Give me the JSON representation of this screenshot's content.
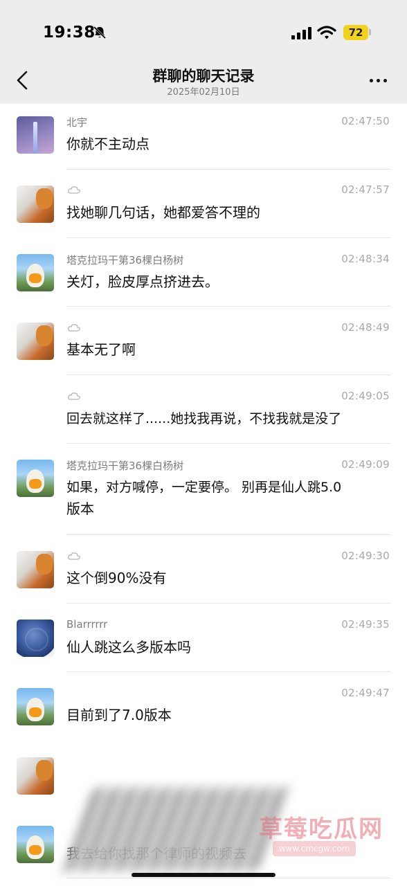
{
  "status": {
    "time": "19:38",
    "battery": "72"
  },
  "header": {
    "title": "群聊的聊天记录",
    "date": "2025年02月10日"
  },
  "messages": [
    {
      "sender": "北宇",
      "avatar": "tower-avatar",
      "time": "02:47:50",
      "text": "你就不主动点"
    },
    {
      "sender": "",
      "avatar": "dog-avatar",
      "sender_icon": "cloud-icon",
      "time": "02:47:57",
      "text": "找她聊几句话，她都爱答不理的"
    },
    {
      "sender": "塔克拉玛干第36棵白杨树",
      "avatar": "duck-avatar",
      "time": "02:48:34",
      "text": "关灯，脸皮厚点挤进去。"
    },
    {
      "sender": "",
      "avatar": "dog-avatar",
      "sender_icon": "cloud-icon",
      "time": "02:48:49",
      "text": "基本无了啊"
    },
    {
      "sender": "",
      "avatar": "",
      "sender_icon": "cloud-icon",
      "time": "02:49:05",
      "text": "回去就这样了......她找我再说，不找我就是没了"
    },
    {
      "sender": "塔克拉玛干第36棵白杨树",
      "avatar": "duck-avatar",
      "time": "02:49:09",
      "text_line1": "如果，对方喊停，一定要停。 别再是仙人跳5.0",
      "text_line2": "版本"
    },
    {
      "sender": "",
      "avatar": "dog-avatar",
      "sender_icon": "cloud-icon",
      "time": "02:49:30",
      "text": "这个倒90%没有"
    },
    {
      "sender": "Blarrrrrr",
      "avatar": "blueberry-avatar",
      "time": "02:49:35",
      "text": "仙人跳这么多版本吗"
    },
    {
      "sender": "",
      "avatar": "duck-avatar",
      "time": "02:49:47",
      "text": "目前到了7.0版本"
    },
    {
      "sender": "",
      "avatar": "dog-avatar",
      "time": "",
      "text": ""
    },
    {
      "sender": "",
      "avatar": "duck-avatar",
      "time": "",
      "text": "我去给你找那个律师的视频去"
    }
  ],
  "watermark": {
    "main": "草莓吃瓜网",
    "url": "www.cmcgw.com"
  },
  "colors": {
    "header_bg": "#ededed",
    "battery": "#f2d21c",
    "timestamp": "#a8a8a8"
  }
}
